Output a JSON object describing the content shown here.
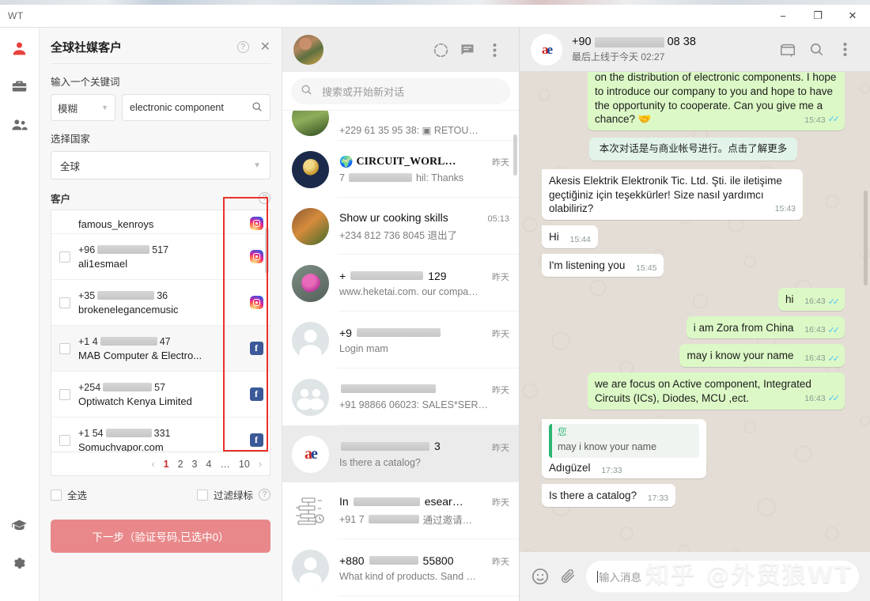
{
  "window": {
    "app_name": "WT",
    "minimize": "−",
    "maximize": "❐",
    "close": "✕"
  },
  "rail": {
    "items": [
      {
        "name": "contacts",
        "icon": "person-icon",
        "active": true
      },
      {
        "name": "toolbox",
        "icon": "briefcase-icon",
        "active": false
      },
      {
        "name": "groups",
        "icon": "people-icon",
        "active": false
      }
    ],
    "bottom": [
      {
        "name": "tutorial",
        "icon": "graduation-cap-icon"
      },
      {
        "name": "settings",
        "icon": "gear-icon"
      }
    ]
  },
  "search_panel": {
    "title": "全球社媒客户",
    "help_icon": "?",
    "close_icon": "✕",
    "keyword_label": "输入一个关键词",
    "match_mode": "模糊",
    "keyword_value": "electronic component",
    "keyword_placeholder": "electronic component",
    "country_label": "选择国家",
    "country_value": "全球",
    "customers_label": "客户",
    "customers": [
      {
        "phone": "",
        "name": "famous_kenroys",
        "platform": "instagram",
        "partial": true
      },
      {
        "phone_prefix": "+96",
        "phone_suffix": "517",
        "name": "ali1esmael",
        "platform": "instagram"
      },
      {
        "phone_prefix": "+35",
        "phone_suffix": "36",
        "name": "brokenelegancemusic",
        "platform": "instagram"
      },
      {
        "phone_prefix": "+1 4",
        "phone_suffix": "47",
        "name": "MAB Computer & Electro...",
        "platform": "facebook",
        "highlighted": true
      },
      {
        "phone_prefix": "+254",
        "phone_suffix": "57",
        "name": "Optiwatch Kenya Limited",
        "platform": "facebook"
      },
      {
        "phone_prefix": "+1 54",
        "phone_suffix": "331",
        "name": "Somuchvapor.com",
        "platform": "facebook"
      }
    ],
    "pagination": {
      "prev": "‹",
      "pages": [
        "1",
        "2",
        "3",
        "4",
        "…",
        "10"
      ],
      "current": "1",
      "next": "›"
    },
    "select_all_label": "全选",
    "filter_green_label": "过滤绿标",
    "filter_help_icon": "?",
    "next_button": "下一步（验证号码,已选中0）"
  },
  "chat_list": {
    "status_icon": "status-ring-icon",
    "new_chat_icon": "new-chat-icon",
    "menu_icon": "more-vertical-icon",
    "search_placeholder": "搜索或开始新对话",
    "search_icon": "search-icon",
    "rows": [
      {
        "avatar": "leaf",
        "title": "",
        "time": "",
        "message": "+229 61 35 95 38: ▣ RETOU…",
        "partial": true
      },
      {
        "avatar": "circuit",
        "title": "CIRCUIT_WORL…",
        "title_emoji": "🌍",
        "time": "昨天",
        "message_prefix": "7",
        "message": "hil: Thanks",
        "bold_title": true,
        "redacted": true
      },
      {
        "avatar": "food",
        "title": "Show ur cooking skills",
        "time": "05:13",
        "message": "+234 812 736 8045 退出了"
      },
      {
        "avatar": "flower",
        "title_prefix": "+",
        "title_suffix": "129",
        "time": "昨天",
        "message": "www.heketai.com. our compa…",
        "redacted_title": true
      },
      {
        "avatar": "person",
        "title_prefix": "+9",
        "title_suffix": "",
        "time": "昨天",
        "message": "Login mam",
        "redacted_title": true
      },
      {
        "avatar": "group",
        "title_prefix": "",
        "title_suffix": "",
        "time": "昨天",
        "message": "+91 98866 06023: SALES*SER…",
        "redacted_title": true
      },
      {
        "avatar": "ae",
        "title_prefix": "",
        "title_suffix": "3",
        "time": "昨天",
        "message": "Is there a catalog?",
        "redacted_title": true,
        "selected": true
      },
      {
        "avatar": "diagram",
        "title_prefix": "In",
        "title_suffix": "esear…",
        "time": "昨天",
        "message_prefix": "+91 7",
        "message": "通过邀请…",
        "redacted_title": true
      },
      {
        "avatar": "person",
        "title_prefix": "+880",
        "title_suffix": "55800",
        "time": "昨天",
        "message": "What kind of products. Sand …",
        "redacted_title": true
      }
    ]
  },
  "chat": {
    "contact_prefix": "+90",
    "contact_suffix": "08 38",
    "status": "最后上线于今天",
    "status_time": "02:27",
    "catalog_icon": "storefront-icon",
    "search_icon": "search-icon",
    "menu_icon": "more-vertical-icon",
    "messages": [
      {
        "side": "out",
        "text": "on the distribution of electronic components. I hope to introduce our company to you and hope to have the opportunity to cooperate. Can you give me a chance? 🤝",
        "time": "15:43",
        "ticks": true,
        "clipped": true
      },
      {
        "side": "center",
        "text": "本次对话是与商业帐号进行。点击了解更多"
      },
      {
        "side": "in",
        "text": "Akesis Elektrik Elektronik Tic. Ltd. Şti. ile iletişime geçtiğiniz için teşekkürler! Size nasıl yardımcı olabiliriz?",
        "time": "15:43"
      },
      {
        "side": "in",
        "text": "Hi",
        "time": "15:44",
        "inline": true
      },
      {
        "side": "in",
        "text": "I'm listening you",
        "time": "15:45",
        "inline": true
      },
      {
        "side": "out",
        "text": "hi",
        "time": "16:43",
        "ticks": true,
        "inline": true
      },
      {
        "side": "out",
        "text": "i am Zora from China",
        "time": "16:43",
        "ticks": true,
        "inline": true
      },
      {
        "side": "out",
        "text": "may i know your name",
        "time": "16:43",
        "ticks": true,
        "inline": true
      },
      {
        "side": "out",
        "text": "we are focus on Active component, Integrated Circuits (ICs), Diodes, MCU ,ect.",
        "time": "16:43",
        "ticks": true
      },
      {
        "side": "in",
        "text": "Adıgüzel",
        "time": "17:33",
        "quote": {
          "author": "您",
          "text": "may i know your name"
        },
        "inline": true
      },
      {
        "side": "in",
        "text": "Is there a catalog?",
        "time": "17:33",
        "inline": true
      }
    ],
    "compose": {
      "emoji_icon": "emoji-icon",
      "attach_icon": "paperclip-icon",
      "placeholder": "输入消息"
    }
  },
  "watermark": "知乎 @外贸狼WT"
}
